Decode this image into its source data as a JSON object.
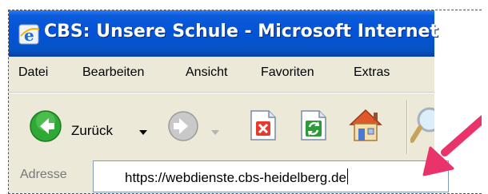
{
  "window": {
    "title": "CBS: Unsere Schule - Microsoft Internet"
  },
  "menu": {
    "items": [
      "Datei",
      "Bearbeiten",
      "Ansicht",
      "Favoriten",
      "Extras"
    ]
  },
  "toolbar": {
    "back_label": "Zurück",
    "icons": [
      "back-icon",
      "chevron-down-icon",
      "forward-icon",
      "stop-icon",
      "refresh-icon",
      "home-icon",
      "search-icon"
    ]
  },
  "address": {
    "label": "Adresse",
    "value": "https://webdienste.cbs-heidelberg.de"
  },
  "annotation": {
    "arrow_color": "#e8336b"
  },
  "colors": {
    "titlebar": "#0453d7",
    "chrome": "#ece9d8"
  }
}
